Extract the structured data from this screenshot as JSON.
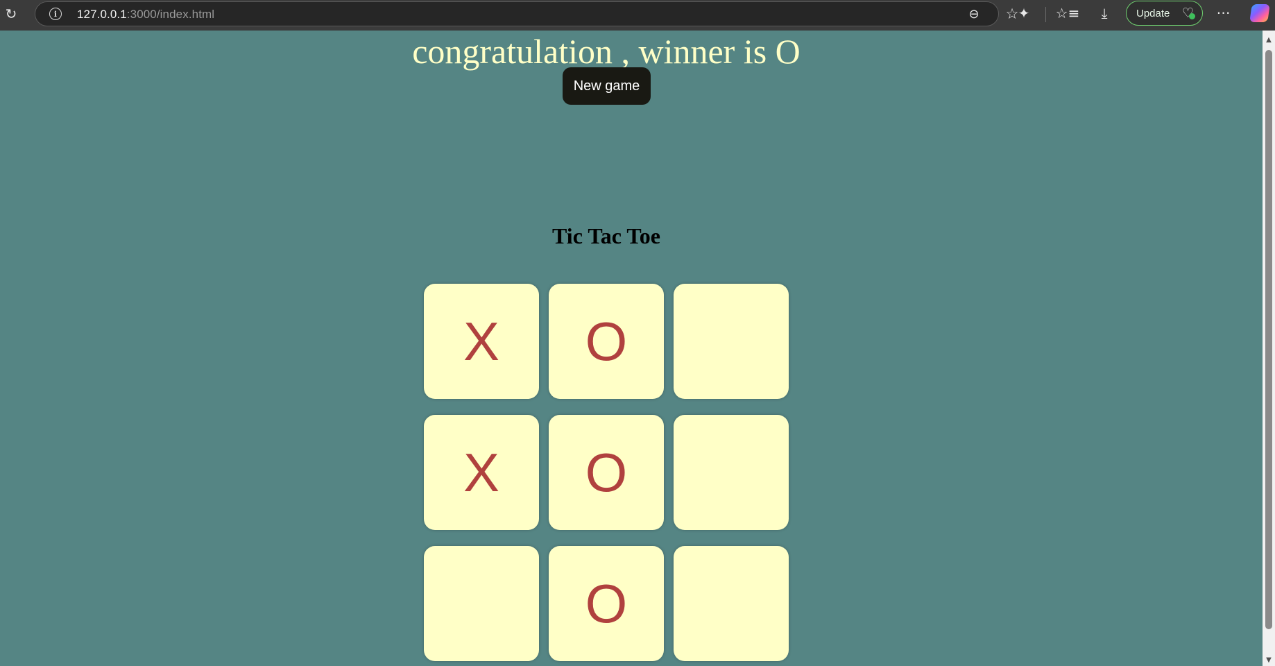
{
  "browser": {
    "url_host": "127.0.0.1",
    "url_rest": ":3000/index.html",
    "update_label": "Update",
    "icons": {
      "reload": "reload-icon",
      "info": "info-icon",
      "zoom": "zoom-out-icon",
      "favorite": "star-icon",
      "extensions": "puzzle-icon",
      "favorites": "favorites-icon",
      "downloads": "download-icon",
      "update_health": "heart-pulse-icon",
      "more": "more-icon",
      "copilot": "copilot-icon"
    }
  },
  "game": {
    "winner_message": "congratulation , winner is O",
    "new_game_label": "New game",
    "title": "Tic Tac Toe",
    "board": [
      [
        "X",
        "O",
        ""
      ],
      [
        "X",
        "O",
        ""
      ],
      [
        "",
        "O",
        ""
      ]
    ]
  },
  "colors": {
    "page_background": "#558584",
    "cell_background": "#ffffc7",
    "mark_color": "#b0413e",
    "winner_text": "#ffffc7",
    "button_background": "#191913",
    "update_border": "#6fd06f"
  }
}
